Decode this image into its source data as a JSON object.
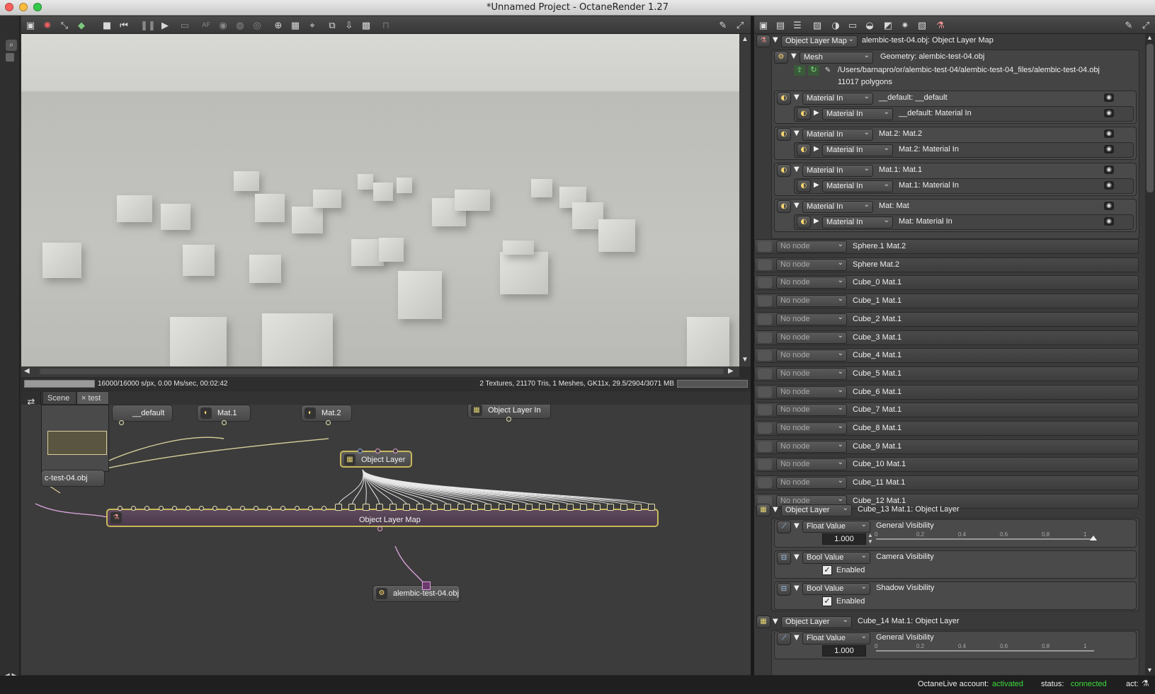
{
  "window": {
    "title": "*Unnamed Project - OctaneRender 1.27"
  },
  "render": {
    "stats_left": "16000/16000 s/px, 0.00 Ms/sec, 00:02:42",
    "stats_right": "2 Textures, 21170 Tris, 1 Meshes, GK11x, 29.5/2904/3071 MB",
    "progress": 1.0
  },
  "node_editor": {
    "tabs": [
      {
        "label": "Scene"
      },
      {
        "label": "test",
        "close": "×"
      }
    ],
    "nodes": {
      "default": "__default",
      "mat1": "Mat.1",
      "mat2": "Mat.2",
      "object_layer_in": "Object Layer In",
      "object_layer": "Object Layer",
      "object_layer_map": "Object Layer Map",
      "mesh_left": "c-test-04.obj",
      "mesh": "alembic-test-04.obj"
    }
  },
  "inspector": {
    "header": {
      "type": "Object Layer Map",
      "title": "alembic-test-04.obj:  Object Layer Map"
    },
    "mesh": {
      "type": "Mesh",
      "label": "Geometry:  alembic-test-04.obj",
      "path": "/Users/barnapro/or/alembic-test-04/alembic-test-04_files/alembic-test-04.obj",
      "polygons": "11017 polygons"
    },
    "materials": [
      {
        "type": "Material In",
        "label": "__default:  __default",
        "child_type": "Material In",
        "child_label": "__default:  Material In"
      },
      {
        "type": "Material In",
        "label": "Mat.2:  Mat.2",
        "child_type": "Material In",
        "child_label": "Mat.2:  Material In"
      },
      {
        "type": "Material In",
        "label": "Mat.1:  Mat.1",
        "child_type": "Material In",
        "child_label": "Mat.1:  Material In"
      },
      {
        "type": "Material In",
        "label": "Mat:  Mat",
        "child_type": "Material In",
        "child_label": "Mat:  Material In"
      }
    ],
    "no_node_label": "No node",
    "layers": [
      "Sphere.1 Mat.2",
      "Sphere Mat.2",
      "Cube_0 Mat.1",
      "Cube_1 Mat.1",
      "Cube_2 Mat.1",
      "Cube_3 Mat.1",
      "Cube_4 Mat.1",
      "Cube_5 Mat.1",
      "Cube_6 Mat.1",
      "Cube_7 Mat.1",
      "Cube_8 Mat.1",
      "Cube_9 Mat.1",
      "Cube_10 Mat.1",
      "Cube_11 Mat.1",
      "Cube_12 Mat.1"
    ],
    "object_layer_13": {
      "type": "Object Layer",
      "label": "Cube_13 Mat.1:  Object Layer",
      "float_type": "Float Value",
      "float_label": "General Visibility",
      "float_value": "1.000",
      "cam_type": "Bool Value",
      "cam_label": "Camera Visibility",
      "cam_checkbox": "Enabled",
      "shadow_type": "Bool Value",
      "shadow_label": "Shadow Visibility",
      "shadow_checkbox": "Enabled"
    },
    "object_layer_14": {
      "type": "Object Layer",
      "label": "Cube_14 Mat.1:  Object Layer",
      "float_type": "Float Value",
      "float_label": "General Visibility",
      "float_value": "1.000"
    },
    "slider_ticks": [
      "0",
      "0.2",
      "0.4",
      "0.6",
      "0.8",
      "1"
    ]
  },
  "statusbar": {
    "account_label": "OctaneLive account:",
    "account_value": "activated",
    "status_label": "status:",
    "status_value": "connected",
    "act_label": "act:",
    "ok_color": "#3ddc3d"
  }
}
